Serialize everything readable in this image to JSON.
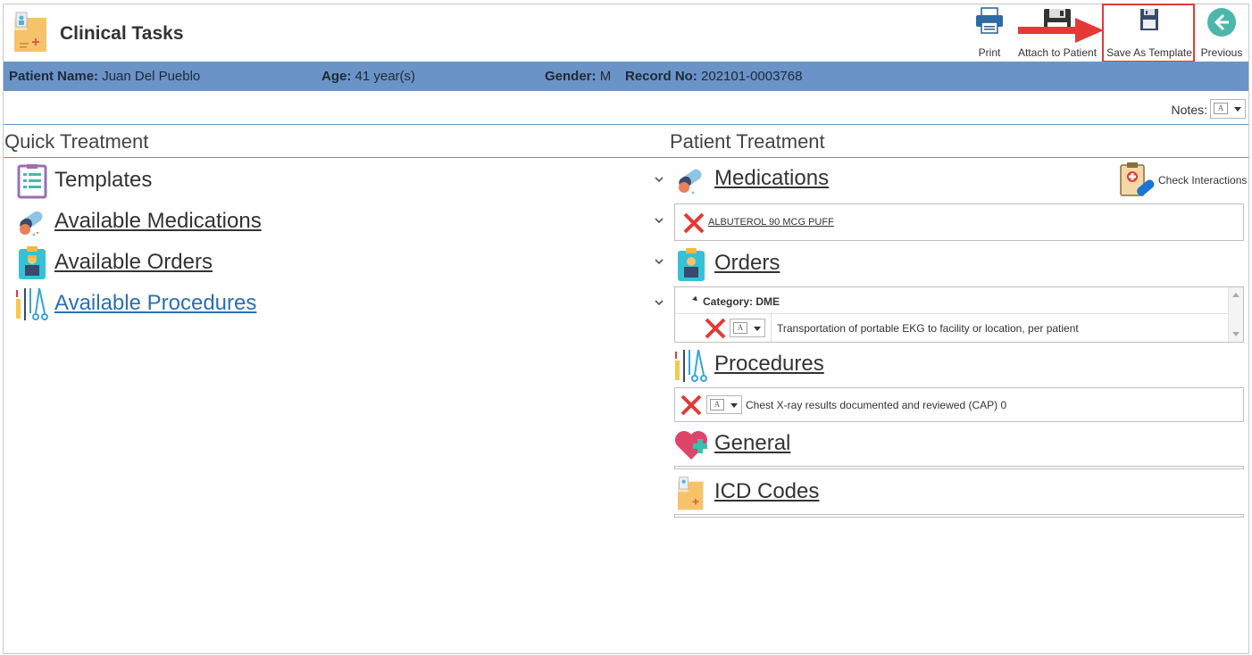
{
  "header": {
    "title": "Clinical Tasks",
    "toolbar": {
      "print": "Print",
      "attach": "Attach to Patient",
      "save_template": "Save As Template",
      "previous": "Previous"
    }
  },
  "patient": {
    "name_label": "Patient Name:",
    "name": "Juan Del Pueblo",
    "age_label": "Age:",
    "age": "41 year(s)",
    "gender_label": "Gender:",
    "gender": "M",
    "record_label": "Record No:",
    "record": "202101-0003768"
  },
  "notes": {
    "label": "Notes:"
  },
  "quick_treatment": {
    "title": "Quick Treatment",
    "items": [
      {
        "label": "Templates"
      },
      {
        "label": "Available Medications"
      },
      {
        "label": "Available Orders"
      },
      {
        "label": "Available Procedures"
      }
    ]
  },
  "patient_treatment": {
    "title": "Patient Treatment",
    "check_interactions": "Check Interactions",
    "medications": {
      "title": "Medications",
      "items": [
        "ALBUTEROL 90 MCG PUFF"
      ]
    },
    "orders": {
      "title": "Orders",
      "category": "Category: DME",
      "items": [
        "Transportation of portable EKG to facility or location, per patient"
      ]
    },
    "procedures": {
      "title": "Procedures",
      "items": [
        "Chest X-ray results documented and reviewed (CAP) 0"
      ]
    },
    "general": {
      "title": "General"
    },
    "icd": {
      "title": "ICD Codes"
    }
  },
  "colors": {
    "patient_bar": "#6a93c8",
    "highlight": "#e53935",
    "link_blue": "#2a6fb5"
  }
}
